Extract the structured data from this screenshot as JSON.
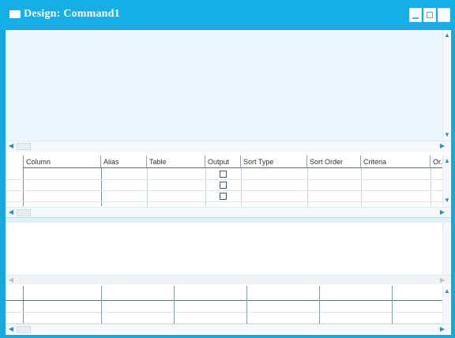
{
  "window": {
    "title": "Design: Command1"
  },
  "grid": {
    "columns": [
      "Column",
      "Alias",
      "Table",
      "Output",
      "Sort Type",
      "Sort Order",
      "Criteria",
      "Or..."
    ]
  },
  "colors": {
    "titlebar": "#15aee6",
    "pane": "#edf7fd"
  },
  "icons": [
    "window-icon",
    "minimize-icon",
    "maximize-icon",
    "close-icon",
    "arrow-up-icon",
    "arrow-down-icon",
    "arrow-left-icon",
    "arrow-right-icon"
  ]
}
